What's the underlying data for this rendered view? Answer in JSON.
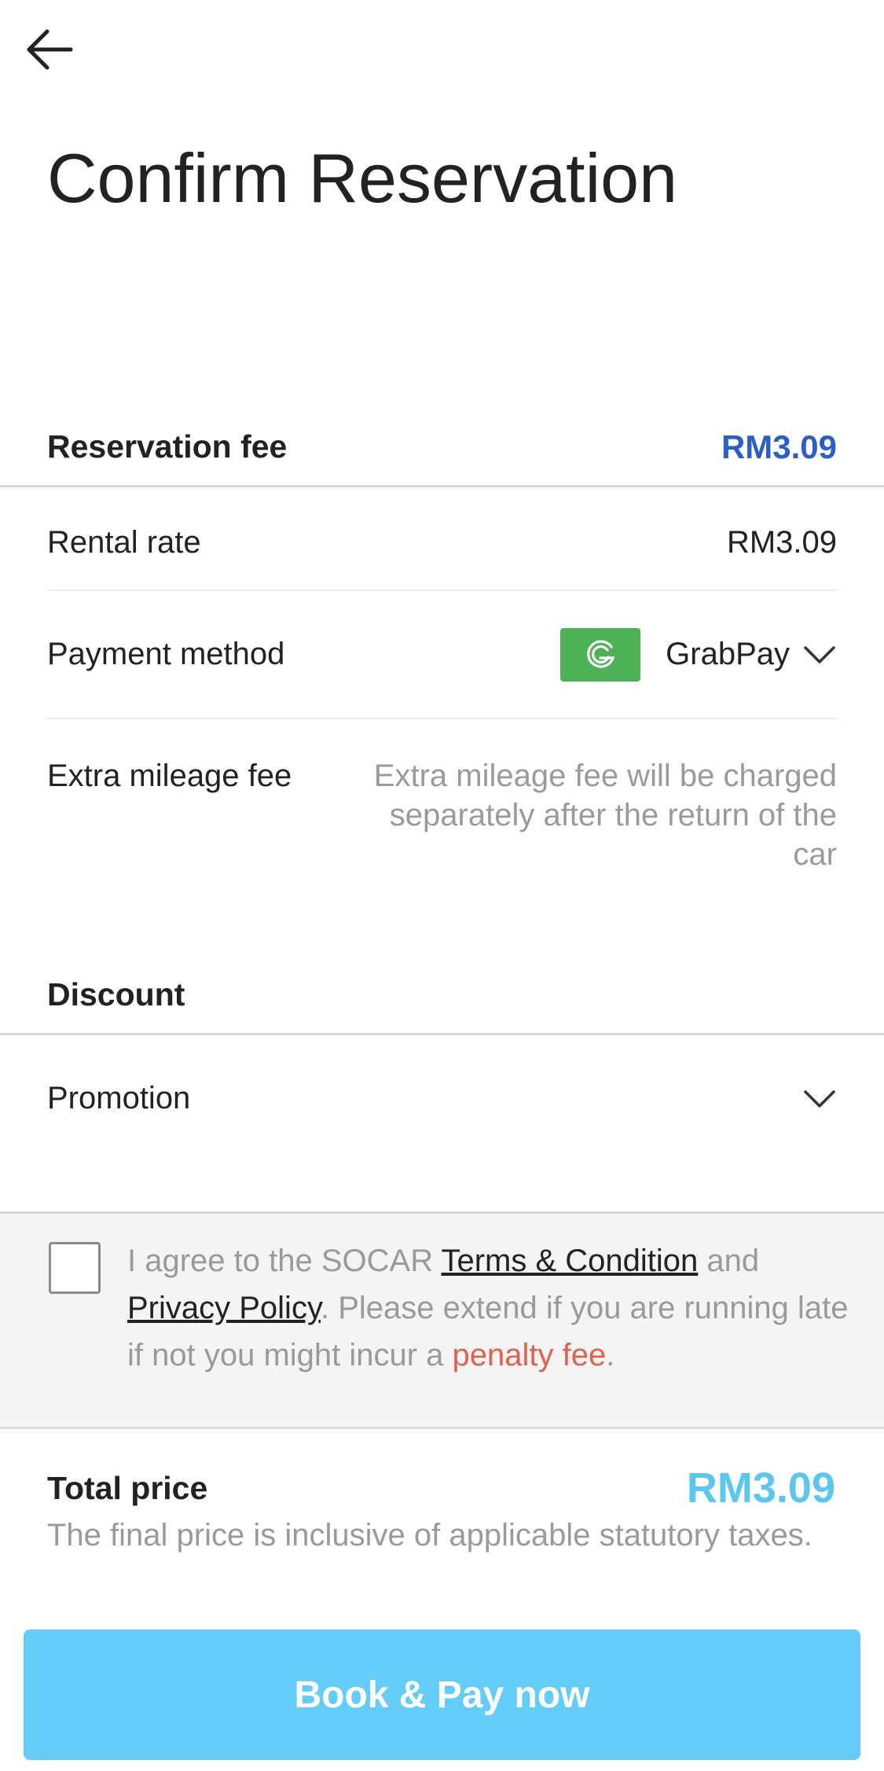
{
  "header": {
    "title": "Confirm Reservation",
    "back_icon": "arrow-left-icon"
  },
  "reservation": {
    "section_label": "Reservation fee",
    "section_amount": "RM3.09",
    "accent_color": "#2b5fc7",
    "rental_rate_label": "Rental rate",
    "rental_rate_value": "RM3.09",
    "payment_method_label": "Payment method",
    "payment_method_value": "GrabPay",
    "payment_icon": "grab-logo-icon",
    "payment_icon_color": "#4cb255",
    "extra_mileage_label": "Extra mileage fee",
    "extra_mileage_note": "Extra mileage fee will be charged separately after the return of the car"
  },
  "discount": {
    "section_label": "Discount",
    "promotion_label": "Promotion"
  },
  "agreement": {
    "checked": false,
    "text_prefix": "I agree to the SOCAR ",
    "terms_link": "Terms & Condition",
    "text_and": " and ",
    "privacy_link": "Privacy Policy",
    "text_middle": ". Please extend if you are running late if not you might incur a ",
    "penalty_text": "penalty fee",
    "penalty_color": "#e0624e",
    "text_suffix": "."
  },
  "total": {
    "label": "Total price",
    "amount": "RM3.09",
    "note": "The final price is inclusive of applicable statutory taxes.",
    "amount_color": "#5bc6ee"
  },
  "cta": {
    "label": "Book & Pay now",
    "color": "#63cdf7"
  }
}
